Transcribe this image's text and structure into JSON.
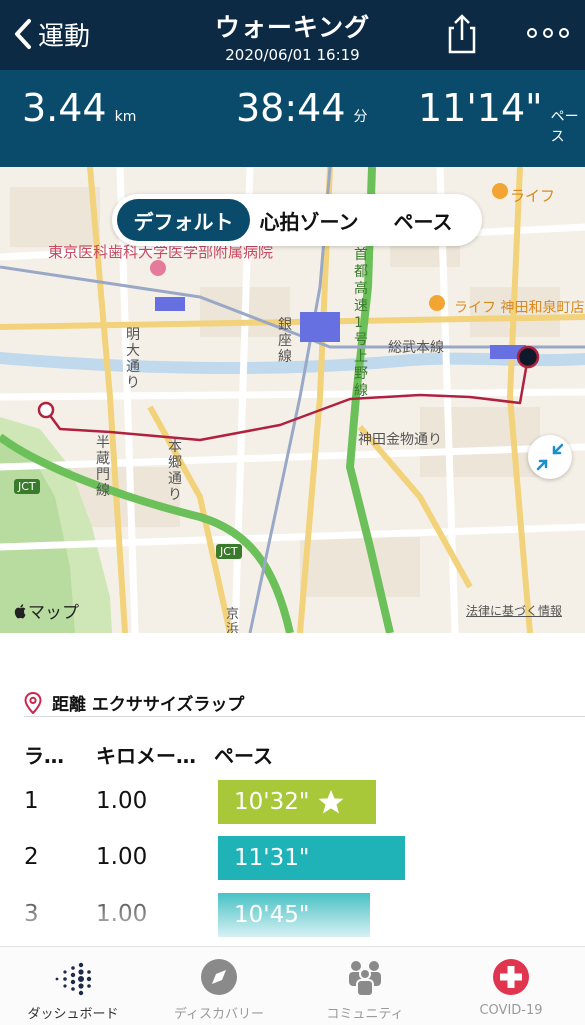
{
  "header": {
    "back_label": "運動",
    "title": "ウォーキング",
    "datetime": "2020/06/01 16:19"
  },
  "stats": [
    {
      "value": "3.44",
      "unit": "km"
    },
    {
      "value": "38:44",
      "unit": "分"
    },
    {
      "value": "11'14\"",
      "unit": "ペース"
    }
  ],
  "map": {
    "segments": [
      "デフォルト",
      "心拍ゾーン",
      "ペース"
    ],
    "active_segment": "デフォルト",
    "labels": {
      "hospital": "東京医科歯科大学医学部附属病院",
      "life1": "ライフ",
      "life2": "ライフ 神田和泉町店",
      "sobu_line": "総武本線",
      "ginza_line": "銀座線",
      "shuto": "首都高速1号上野線",
      "meidai": "明大通り",
      "hanzomon": "半蔵門線",
      "hongo": "本郷通り",
      "kanda_kanamono": "神田金物通り",
      "jct": "JCT",
      "keihin": "京浜"
    },
    "brand": "マップ",
    "legal": "法律に基づく情報"
  },
  "laps": {
    "section_title": "距離 エクササイズラップ",
    "headers": {
      "lap": "ラ…",
      "km": "キロメー…",
      "pace": "ペース"
    },
    "rows": [
      {
        "lap": "1",
        "km": "1.00",
        "pace": "10'32\"",
        "pace_fraction": 0.27,
        "color": "#a8c83a",
        "best": true
      },
      {
        "lap": "2",
        "km": "1.00",
        "pace": "11'31\"",
        "pace_fraction": 0.32,
        "color": "#1fb3b8",
        "best": false
      },
      {
        "lap": "3",
        "km": "1.00",
        "pace": "10'45\"",
        "pace_fraction": 0.26,
        "color": "#1fb3b8",
        "best": false
      }
    ]
  },
  "tabs": [
    {
      "label": "ダッシュボード",
      "icon": "dashboard-dots-icon",
      "active": true
    },
    {
      "label": "ディスカバリー",
      "icon": "compass-icon",
      "active": false
    },
    {
      "label": "コミュニティ",
      "icon": "community-icon",
      "active": false
    },
    {
      "label": "COVID-19",
      "icon": "red-cross-icon",
      "active": false
    }
  ],
  "colors": {
    "header_bg": "#0d2a45",
    "stats_bg": "#0a4b6c",
    "route": "#b0203f",
    "best_lap": "#a8c83a",
    "lap": "#1fb3b8"
  }
}
